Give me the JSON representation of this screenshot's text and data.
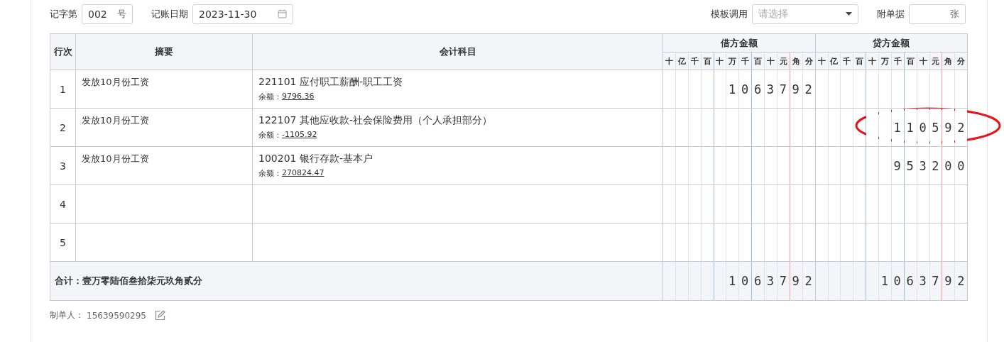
{
  "toolbar": {
    "voucher_word_label": "记字第",
    "voucher_number": "002",
    "voucher_number_suffix": "号",
    "date_label": "记账日期",
    "date": "2023-11-30",
    "template_label": "模板调用",
    "template_placeholder": "请选择",
    "attachments_label": "附单据",
    "attachments_suffix": "张"
  },
  "table": {
    "columns": {
      "line_no": "行次",
      "summary": "摘要",
      "account": "会计科目",
      "debit": "借方金额",
      "credit": "贷方金额"
    },
    "debit_units": [
      "十",
      "亿",
      "千",
      "百",
      "十",
      "万",
      "千",
      "百",
      "十",
      "元",
      "角",
      "分"
    ],
    "credit_units": [
      "十",
      "亿",
      "千",
      "百",
      "十",
      "万",
      "千",
      "百",
      "十",
      "元",
      "角",
      "分"
    ],
    "rows": [
      {
        "line_no": "1",
        "summary": "发放10月份工资",
        "account": "221101 应付职工薪酬-职工工资",
        "balance_label": "余额：",
        "balance": "9796.36",
        "debit": "1063792",
        "circled": false
      },
      {
        "line_no": "2",
        "summary": "发放10月份工资",
        "account": "122107 其他应收款-社会保险费用（个人承担部分）",
        "balance_label": "余额：",
        "balance": "-1105.92",
        "credit": "110592",
        "circled": true
      },
      {
        "line_no": "3",
        "summary": "发放10月份工资",
        "account": "100201 银行存款-基本户",
        "balance_label": "余额：",
        "balance": "270824.47",
        "credit": "953200",
        "circled": false
      },
      {
        "line_no": "4",
        "circled": false
      },
      {
        "line_no": "5",
        "circled": false
      }
    ],
    "total": {
      "label": "合计：壹万零陆佰叁拾柒元玖角贰分",
      "debit": "1063792",
      "credit": "1063792"
    }
  },
  "footer": {
    "maker_label": "制单人：",
    "maker": "15639590295"
  }
}
